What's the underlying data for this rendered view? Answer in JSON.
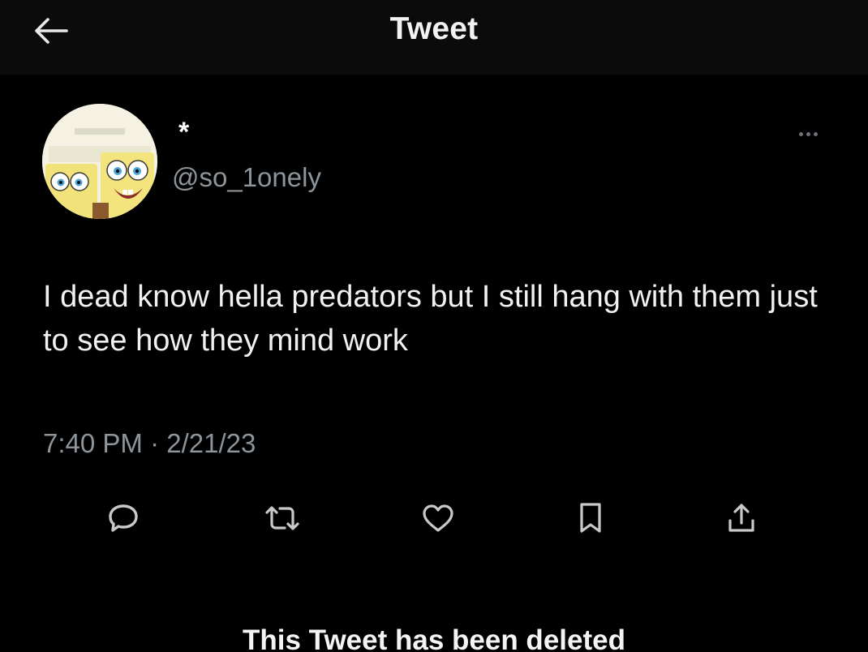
{
  "header": {
    "title": "Tweet",
    "back_icon": "arrow-left-icon"
  },
  "tweet": {
    "author": {
      "display_name": "*",
      "handle": "@so_1onely"
    },
    "text": "I dead know hella predators but I still hang with them just to see how they mind work",
    "timestamp": "7:40 PM · 2/21/23",
    "more_icon": "more-horizontal-icon",
    "actions": [
      {
        "name": "reply",
        "icon": "speech-bubble-icon"
      },
      {
        "name": "retweet",
        "icon": "retweet-icon"
      },
      {
        "name": "like",
        "icon": "heart-icon"
      },
      {
        "name": "bookmark",
        "icon": "bookmark-icon"
      },
      {
        "name": "share",
        "icon": "share-icon"
      }
    ]
  },
  "notice": {
    "text": "This Tweet has been deleted"
  },
  "colors": {
    "background": "#000000",
    "header_background": "#0b0b0b",
    "primary_text": "#f1f1f1",
    "secondary_text": "#8d949a",
    "icon": "#c7c9cb"
  }
}
